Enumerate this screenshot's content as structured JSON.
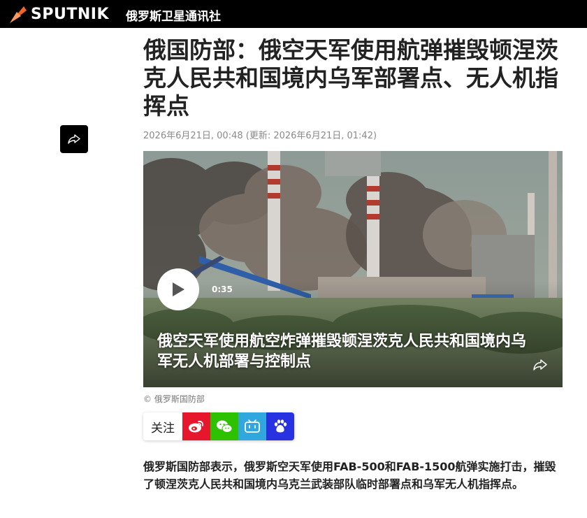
{
  "header": {
    "logo_text": "SPUTNIK",
    "site_name": "俄罗斯卫星通讯社",
    "accent_color": "#f26522"
  },
  "article": {
    "title": "俄国防部：俄空天军使用航弹摧毁顿涅茨克人民共和国境内乌军部署点、无人机指挥点",
    "meta": "2026年6月21日, 00:48 (更新: 2026年6月21日, 01:42)",
    "lead": "俄罗斯国防部表示，俄罗斯空天军使用FAB-500和FAB-1500航弹实施打击，摧毁了顿涅茨克人民共和国境内乌克兰武装部队临时部署点和乌军无人机指挥点。"
  },
  "video": {
    "duration": "0:35",
    "caption": "俄空天军使用航空炸弹摧毁顿涅茨克人民共和国境内乌军无人机部署与控制点",
    "credit": "© 俄罗斯国防部"
  },
  "follow": {
    "label": "关注",
    "icons": [
      "weibo-icon",
      "wechat-icon",
      "bilibili-icon",
      "baidu-icon"
    ]
  },
  "icons": {
    "share": "share-arrow-icon",
    "play": "play-icon"
  }
}
